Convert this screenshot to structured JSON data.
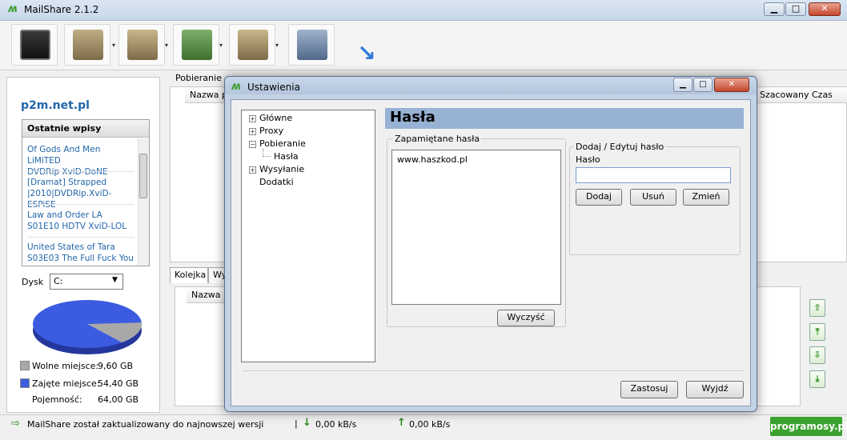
{
  "app": {
    "title": "MailShare 2.1.2",
    "logo_glyph": "ʍ"
  },
  "window_controls": {
    "minimize": "▁",
    "maximize": "□",
    "close": "✕"
  },
  "toolbar": {
    "items": [
      {
        "name": "console-icon",
        "color": "#1a1a1a"
      },
      {
        "name": "download-folder-icon",
        "color": "#8a7a55"
      },
      {
        "name": "edit-folder-icon",
        "color": "#8a7a55"
      },
      {
        "name": "settings-folder-icon",
        "color": "#4e8a3a"
      },
      {
        "name": "user-folder-icon",
        "color": "#8a7a55"
      },
      {
        "name": "network-icon",
        "color": "#6f86a3"
      },
      {
        "name": "arrow-icon",
        "color": "#2d7ad6"
      }
    ],
    "dropdown_glyph": "▾"
  },
  "left_panel": {
    "site": "p2m.net.pl",
    "recent_title": "Ostatnie wpisy",
    "recent_items": [
      {
        "line1": "Of Gods And Men LiMiTED",
        "line2": "DVDRip XviD-DoNE"
      },
      {
        "line1": "[Dramat] Strapped",
        "line2": "|2010|DVDRip.XviD-ESPiSE"
      },
      {
        "line1": "Law and Order LA",
        "line2": "S01E10 HDTV XviD-LOL"
      },
      {
        "line1": "United States of Tara",
        "line2": "S03E03 The Full Fuck You"
      }
    ],
    "disk_label": "Dysk",
    "disk_value": "C:",
    "pie": {
      "free_fraction": 0.15,
      "free_color": "#a8a8a8",
      "used_color": "#3b5be0"
    },
    "legend": {
      "free_label": "Wolne miejsce:",
      "free_value": "9,60 GB",
      "used_label": "Zajęte miejsce:",
      "used_value": "54,40 GB",
      "capacity_label": "Pojemność:",
      "capacity_value": "64,00 GB"
    }
  },
  "main": {
    "download_label": "Pobieranie",
    "download_cols": {
      "name": "Nazwa p",
      "eta": "Szacowany Czas"
    },
    "queue_tabs": {
      "queue": "Kolejka",
      "other": "Wy"
    },
    "queue_cols": {
      "name": "Nazwa p"
    },
    "arrows": {
      "up": "⇧",
      "top": "⤒",
      "down": "⇩",
      "bottom": "⤓"
    }
  },
  "status": {
    "message": "MailShare został zaktualizowany do najnowszej wersji",
    "divider": "|",
    "down_speed": "0,00 kB/s",
    "up_speed": "0,00 kB/s",
    "watermark": "programosy.pl"
  },
  "dialog": {
    "title": "Ustawienia",
    "tree": {
      "glowne": "Główne",
      "proxy": "Proxy",
      "pobieranie": "Pobieranie",
      "hasla": "Hasła",
      "wysylanie": "Wysyłanie",
      "dodatki": "Dodatki",
      "plus": "+",
      "minus": "−"
    },
    "section_title": "Hasła",
    "saved_group": "Zapamiętane hasła",
    "saved_items": [
      "www.haszkod.pl"
    ],
    "clear_button": "Wyczyść",
    "edit_group": "Dodaj / Edytuj hasło",
    "password_label": "Hasło",
    "password_value": "",
    "add_button": "Dodaj",
    "remove_button": "Usuń",
    "change_button": "Zmień",
    "apply_button": "Zastosuj",
    "exit_button": "Wyjdź"
  }
}
